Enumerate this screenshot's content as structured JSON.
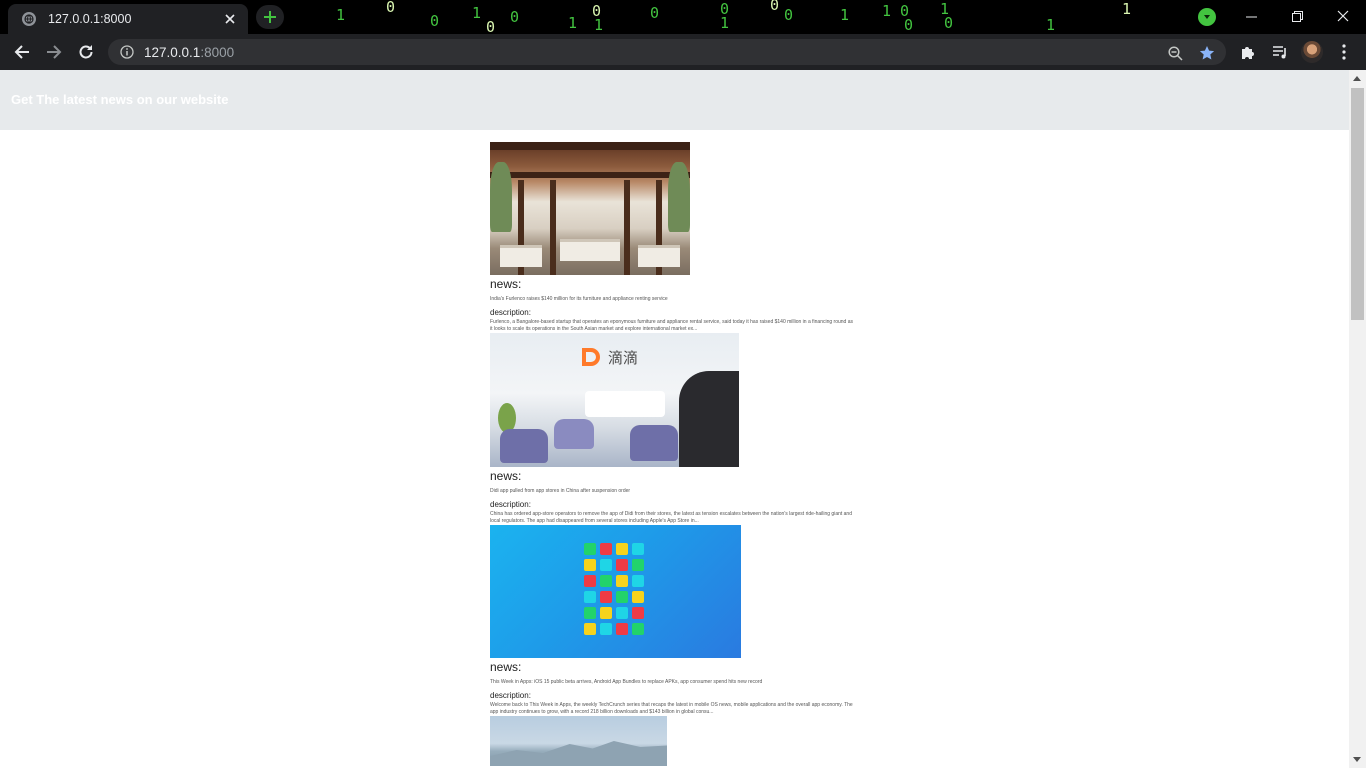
{
  "browser": {
    "tab_title": "127.0.0.1:8000",
    "url_host": "127.0.0.1",
    "url_port": ":8000",
    "matrix_digits": [
      "1",
      "0",
      "0",
      "1",
      "0",
      "0",
      "1",
      "0",
      "1",
      "0",
      "0",
      "1",
      "0",
      "1",
      "0",
      "1",
      "0",
      "1",
      "1",
      "0",
      "0",
      "1"
    ],
    "icons": {
      "tab_favicon": "globe-icon",
      "new_tab": "plus-icon",
      "back": "arrow-left-icon",
      "forward": "arrow-right-icon",
      "reload": "reload-icon",
      "site_info": "info-icon",
      "zoom": "zoom-out-icon",
      "bookmark": "star-icon",
      "extensions": "puzzle-icon",
      "media": "playlist-icon",
      "menu": "kebab-menu-icon"
    },
    "colors": {
      "matrix_green": "#43c440",
      "bookmark_blue": "#8ab4f8"
    }
  },
  "site": {
    "header_title": "Get The latest news on our website",
    "articles": [
      {
        "news_label": "news:",
        "headline": "India's Furlenco raises $140 million for its furniture and appliance renting service",
        "description_label": "description:",
        "description": "Furlenco, a Bangalore-based startup that operates an eponymous furniture and appliance rental service, said today it has raised $140 million in a financing round as it looks to scale its operations in the South Asian market and  explore international market ex..."
      },
      {
        "news_label": "news:",
        "headline": "Didi app pulled from app stores in China after suspension order",
        "description_label": "description:",
        "description": "China has ordered app-store operators to remove the app of Didi from their stores, the latest as tension escalates between the nation's largest ride-hailing giant and local regulators. The app had disappeared from several stores including Apple's App Store in..."
      },
      {
        "news_label": "news:",
        "headline": "This Week in Apps: iOS 15 public beta arrives, Android App Bundles to replace APKs, app consumer spend hits new record",
        "description_label": "description:",
        "description": "Welcome back to This Week in Apps, the weekly TechCrunch series that recaps the latest in mobile OS news, mobile applications and the overall app economy. The app industry continues to grow, with a record 218 billion downloads and $143 billion in global consu..."
      }
    ],
    "image_logo_text": "滴滴"
  }
}
